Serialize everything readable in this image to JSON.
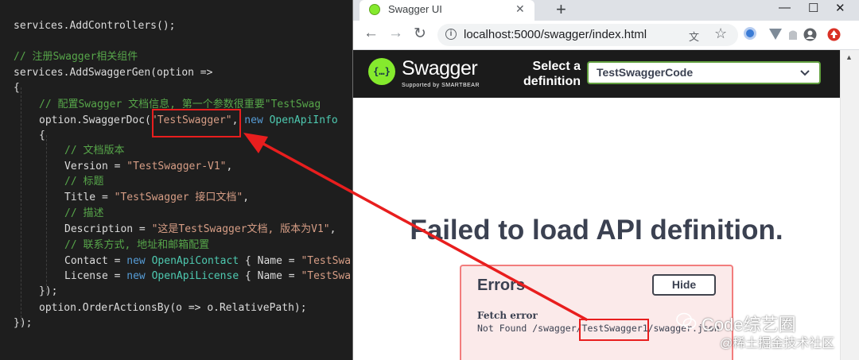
{
  "editor": {
    "lines": [
      {
        "segments": [
          {
            "text": "services.AddControllers();",
            "cls": ""
          }
        ]
      },
      {
        "segments": [
          {
            "text": "// 注册Swagger相关组件",
            "cls": "c"
          }
        ]
      },
      {
        "segments": [
          {
            "text": "services.AddSwaggerGen(option =>",
            "cls": ""
          }
        ]
      },
      {
        "segments": [
          {
            "text": "{",
            "cls": ""
          }
        ]
      },
      {
        "segments": [
          {
            "text": "// 配置Swagger 文档信息, 第一个参数很重要\"TestSwag",
            "cls": "c"
          }
        ]
      },
      {
        "segments": [
          {
            "text": "option.SwaggerDoc(",
            "cls": ""
          },
          {
            "text": "\"TestSwagger\"",
            "cls": "s"
          },
          {
            "text": ", ",
            "cls": ""
          },
          {
            "text": "new",
            "cls": "k"
          },
          {
            "text": " ",
            "cls": ""
          },
          {
            "text": "OpenApiInfo",
            "cls": "t"
          }
        ]
      },
      {
        "segments": [
          {
            "text": "{",
            "cls": ""
          }
        ]
      },
      {
        "segments": [
          {
            "text": "// 文档版本",
            "cls": "c"
          }
        ]
      },
      {
        "segments": [
          {
            "text": "Version = ",
            "cls": ""
          },
          {
            "text": "\"TestSwagger-V1\"",
            "cls": "s"
          },
          {
            "text": ",",
            "cls": ""
          }
        ]
      },
      {
        "segments": [
          {
            "text": "// 标题",
            "cls": "c"
          }
        ]
      },
      {
        "segments": [
          {
            "text": "Title = ",
            "cls": ""
          },
          {
            "text": "\"TestSwagger 接口文档\"",
            "cls": "s"
          },
          {
            "text": ",",
            "cls": ""
          }
        ]
      },
      {
        "segments": [
          {
            "text": "// 描述",
            "cls": "c"
          }
        ]
      },
      {
        "segments": [
          {
            "text": "Description = ",
            "cls": ""
          },
          {
            "text": "\"这是TestSwagger文档, 版本为V1\"",
            "cls": "s"
          },
          {
            "text": ",",
            "cls": ""
          }
        ]
      },
      {
        "segments": [
          {
            "text": "// 联系方式, 地址和邮箱配置",
            "cls": "c"
          }
        ]
      },
      {
        "segments": [
          {
            "text": "Contact = ",
            "cls": ""
          },
          {
            "text": "new",
            "cls": "k"
          },
          {
            "text": " ",
            "cls": ""
          },
          {
            "text": "OpenApiContact",
            "cls": "t"
          },
          {
            "text": " { Name = ",
            "cls": ""
          },
          {
            "text": "\"TestSwa",
            "cls": "s"
          }
        ]
      },
      {
        "segments": [
          {
            "text": "License = ",
            "cls": ""
          },
          {
            "text": "new",
            "cls": "k"
          },
          {
            "text": " ",
            "cls": ""
          },
          {
            "text": "OpenApiLicense",
            "cls": "t"
          },
          {
            "text": " { Name = ",
            "cls": ""
          },
          {
            "text": "\"TestSwa",
            "cls": "s"
          }
        ]
      },
      {
        "segments": [
          {
            "text": "});",
            "cls": ""
          }
        ]
      },
      {
        "segments": [
          {
            "text": "option.OrderActionsBy(o => o.RelativePath);",
            "cls": ""
          }
        ]
      },
      {
        "segments": [
          {
            "text": "});",
            "cls": ""
          }
        ]
      }
    ]
  },
  "browser": {
    "tab_title": "Swagger UI",
    "tab_close": "✕",
    "new_tab": "+",
    "window": {
      "minimize": "—",
      "maximize": "☐",
      "close": "✕"
    },
    "nav": {
      "back": "←",
      "forward": "→",
      "reload": "↻"
    },
    "info_icon": "i",
    "url": "localhost:5000/swagger/index.html",
    "translate_icon": "文",
    "star_icon": "☆"
  },
  "swagger": {
    "logo_glyph": "{…}",
    "brand": "Swagger",
    "brand_sub": "Supported by SMARTBEAR",
    "select_label": "Select a definition",
    "selected_definition": "TestSwaggerCode",
    "fail_title": "Failed to load API definition.",
    "errors_title": "Errors",
    "hide_label": "Hide",
    "error_head": "Fetch error",
    "error_msg": "Not Found /swagger/TestSwagger1/swagger.json"
  },
  "watermark": {
    "title": "Code综艺圈",
    "sub": "@稀土掘金技术社区"
  },
  "colors": {
    "annotation_red": "#e81e1e",
    "swagger_green": "#85ea2d",
    "error_border": "#f27d7d"
  }
}
